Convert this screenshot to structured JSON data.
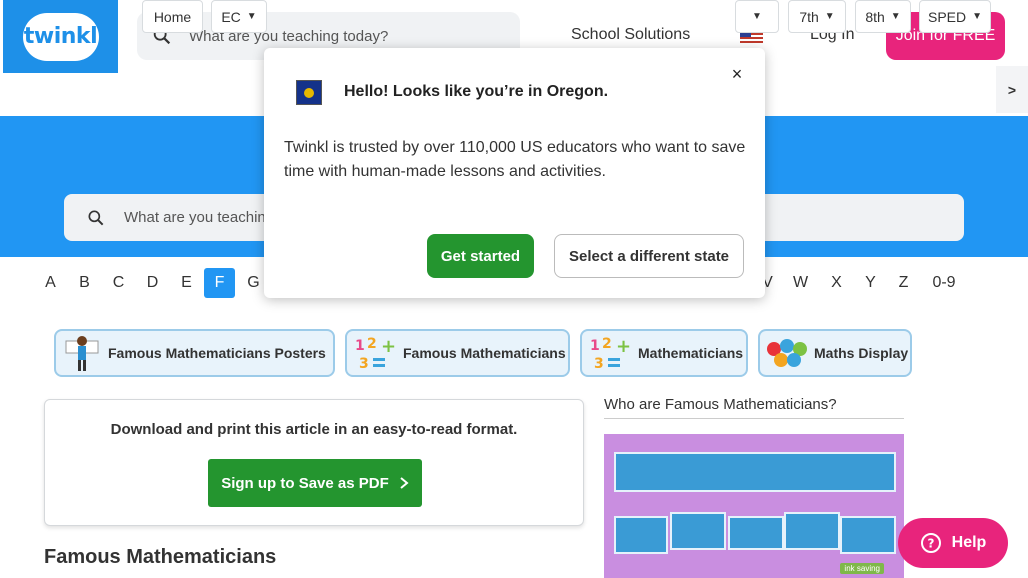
{
  "header": {
    "logo_text": "twinkl",
    "search_placeholder": "What are you teaching today?",
    "school_solutions": "School Solutions",
    "login": "Log In",
    "join": "Join for FREE"
  },
  "grades": [
    "Home",
    "EC",
    "7th",
    "8th",
    "SPED"
  ],
  "more_arrow": ">",
  "hero_search_placeholder": "What are you teaching today?",
  "alphabet": [
    "A",
    "B",
    "C",
    "D",
    "E",
    "F",
    "G",
    "V",
    "W",
    "X",
    "Y",
    "Z",
    "0-9"
  ],
  "active_letter": "F",
  "pills": [
    {
      "label": "Famous Mathematicians Posters"
    },
    {
      "label": "Famous Mathematicians"
    },
    {
      "label": "Mathematicians"
    },
    {
      "label": "Maths Display"
    }
  ],
  "card": {
    "text": "Download and print this article in an easy-to-read format.",
    "button": "Sign up to Save as PDF"
  },
  "article_title": "Famous Mathematicians",
  "sidebar": {
    "link": "Who are Famous Mathematicians?",
    "thumb_label": "ink saving"
  },
  "help": "Help",
  "popup": {
    "title": "Hello! Looks like you’re in Oregon.",
    "close": "×",
    "body": "Twinkl is trusted by over 110,000 US educators who want to save time with human-made lessons and activities.",
    "primary": "Get started",
    "secondary": "Select a different state"
  },
  "colors": {
    "brand_blue": "#2196f3",
    "brand_pink": "#e8247c",
    "cta_green": "#24952f"
  }
}
